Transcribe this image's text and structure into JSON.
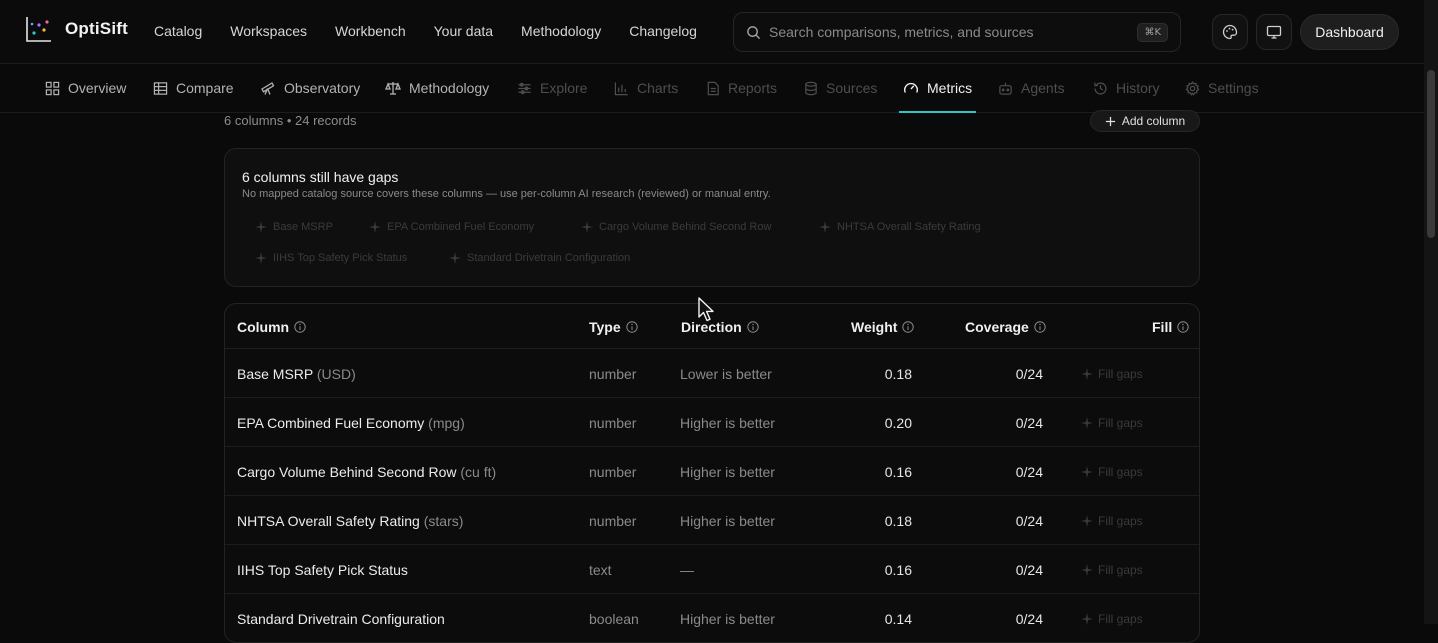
{
  "app": {
    "name": "OptiSift"
  },
  "colors": {
    "accent": "#33c4c4",
    "background": "#0a0a0a"
  },
  "mainnav": [
    "Catalog",
    "Workspaces",
    "Workbench",
    "Your data",
    "Methodology",
    "Changelog"
  ],
  "search": {
    "placeholder": "Search comparisons, metrics, and sources",
    "shortcut": "⌘K",
    "icon": "search-icon"
  },
  "header_actions": {
    "theme_icon": "palette-icon",
    "display_icon": "monitor-icon",
    "dashboard_label": "Dashboard"
  },
  "tabs": [
    {
      "label": "Overview",
      "icon": "grid-icon",
      "state": "normal"
    },
    {
      "label": "Compare",
      "icon": "table-icon",
      "state": "normal"
    },
    {
      "label": "Observatory",
      "icon": "telescope-icon",
      "state": "normal"
    },
    {
      "label": "Methodology",
      "icon": "scale-icon",
      "state": "normal"
    },
    {
      "label": "Explore",
      "icon": "sliders-icon",
      "state": "disabled"
    },
    {
      "label": "Charts",
      "icon": "bar-chart-icon",
      "state": "disabled"
    },
    {
      "label": "Reports",
      "icon": "file-icon",
      "state": "disabled"
    },
    {
      "label": "Sources",
      "icon": "database-icon",
      "state": "disabled"
    },
    {
      "label": "Metrics",
      "icon": "gauge-icon",
      "state": "active"
    },
    {
      "label": "Agents",
      "icon": "bot-icon",
      "state": "disabled"
    },
    {
      "label": "History",
      "icon": "history-icon",
      "state": "disabled"
    },
    {
      "label": "Settings",
      "icon": "gear-icon",
      "state": "disabled"
    }
  ],
  "summary": {
    "text": "6 columns • 24 records",
    "add_column_label": "Add column"
  },
  "gaps": {
    "title": "6 columns still have gaps",
    "subtitle": "No mapped catalog source covers these columns — use per-column AI research (reviewed) or manual entry.",
    "chips": [
      "Base MSRP",
      "EPA Combined Fuel Economy",
      "Cargo Volume Behind Second Row",
      "NHTSA Overall Safety Rating",
      "IIHS Top Safety Pick Status",
      "Standard Drivetrain Configuration"
    ]
  },
  "table": {
    "headers": {
      "column": "Column",
      "type": "Type",
      "direction": "Direction",
      "weight": "Weight",
      "coverage": "Coverage",
      "fill": "Fill"
    },
    "fill_label": "Fill gaps",
    "rows": [
      {
        "name": "Base MSRP",
        "unit": "(USD)",
        "type": "number",
        "direction": "Lower is better",
        "weight": "0.18",
        "coverage": "0/24"
      },
      {
        "name": "EPA Combined Fuel Economy",
        "unit": "(mpg)",
        "type": "number",
        "direction": "Higher is better",
        "weight": "0.20",
        "coverage": "0/24"
      },
      {
        "name": "Cargo Volume Behind Second Row",
        "unit": "(cu ft)",
        "type": "number",
        "direction": "Higher is better",
        "weight": "0.16",
        "coverage": "0/24"
      },
      {
        "name": "NHTSA Overall Safety Rating",
        "unit": "(stars)",
        "type": "number",
        "direction": "Higher is better",
        "weight": "0.18",
        "coverage": "0/24"
      },
      {
        "name": "IIHS Top Safety Pick Status",
        "unit": "",
        "type": "text",
        "direction": "—",
        "weight": "0.16",
        "coverage": "0/24"
      },
      {
        "name": "Standard Drivetrain Configuration",
        "unit": "",
        "type": "boolean",
        "direction": "Higher is better",
        "weight": "0.14",
        "coverage": "0/24"
      }
    ]
  }
}
